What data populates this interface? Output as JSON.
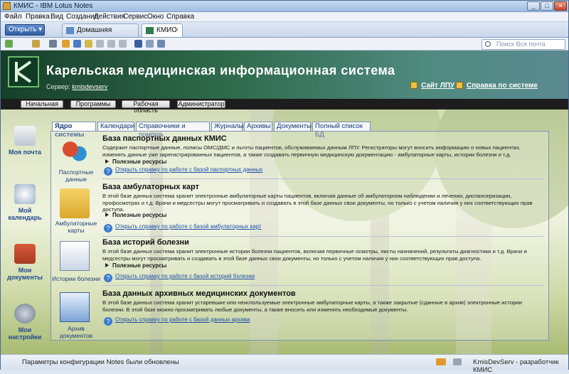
{
  "window": {
    "title": "КМИС - IBM Lotus Notes",
    "controls": [
      "_",
      "□",
      "×"
    ]
  },
  "menu": [
    "Файл",
    "Правка",
    "Вид",
    "Создание",
    "Действия",
    "Сервис",
    "Окно",
    "Справка"
  ],
  "tabs": {
    "open_label": "Открыть",
    "items": [
      {
        "label": "Домашняя страница"
      },
      {
        "label": "КМИС"
      }
    ]
  },
  "search": {
    "placeholder": "Поиск Вся почта"
  },
  "banner": {
    "title": "Карельская медицинская информационная система",
    "server_label": "Сервер:",
    "server_value": "kmisdevserv",
    "link_site": "Сайт ЛПУ",
    "link_help": "Справка по системе"
  },
  "nav_buttons": [
    "Начальная",
    "Программы",
    "Рабочая область",
    "Администратор"
  ],
  "left_nav": [
    {
      "label": "Моя почта"
    },
    {
      "label": "Мой календарь"
    },
    {
      "label": "Мои документы"
    },
    {
      "label": "Мои настройки"
    }
  ],
  "inner_tabs": [
    "Ядро системы",
    "Календари",
    "Справочники и помощь",
    "Журналы",
    "Архивы",
    "Документы",
    "Полный список БД"
  ],
  "sections": [
    {
      "icon_label": "Паспортные данные",
      "title": "База паспортных данных КМИС",
      "desc": "Содержит паспортные данные, полисы ОМС/ДМС и льготы пациентов, обслуживаемых данным ЛПУ. Регистраторы могут вносить информацию о новых пациентах, изменять данные уже зарегистрированных пациентов, а также создавать первичную медицинскую документацию - амбулаторные карты, истории болезни и т.д.",
      "resources": "Полезные ресурсы",
      "help": "Открыть справку по работе с базой паспортных данных"
    },
    {
      "icon_label": "Амбулаторные карты",
      "title": "База амбулаторных карт",
      "desc": "В этой базе данных система хранит электронные амбулаторные карты пациентов, включая данные об амбулаторном наблюдении и лечении, диспансеризации, профосмотрах и т.д. Врачи и медсестры могут просматривать и создавать в этой базе данных свои документы, но только с учетом наличия у них соответствующих прав доступа.",
      "resources": "Полезные ресурсы",
      "help": "Открыть справку по работе с базой амбулаторных карт"
    },
    {
      "icon_label": "Истории болезни",
      "title": "База историй болезни",
      "desc": "В этой базе данных система хранит электронные истории болезни пациентов, включая первичные осмотры, листы назначений, результаты диагностики и т.д. Врачи и медсестры могут просматривать и создавать в этой базе данных свои документы, но только с учетом наличия у них соответствующих прав доступа.",
      "resources": "Полезные ресурсы",
      "help": "Открыть справку по работе с базой историй болезни"
    },
    {
      "icon_label": "Архив документов",
      "title": "База данных архивных медицинских документов",
      "desc": "В этой базе данных система хранит устаревшие или неиспользуемые электронные амбулаторные карты, а также закрытые (сданные в архив) электронные истории болезни. В этой базе можно просматривать любые документы, а также вносить или изменять необходимые документы.",
      "resources": "",
      "help": "Открыть справку по работе с базой данных архива"
    }
  ],
  "status": {
    "message": "Параметры конфигурации Notes были обновлены",
    "user": "KmisDevServ - разработчик КМИС"
  }
}
